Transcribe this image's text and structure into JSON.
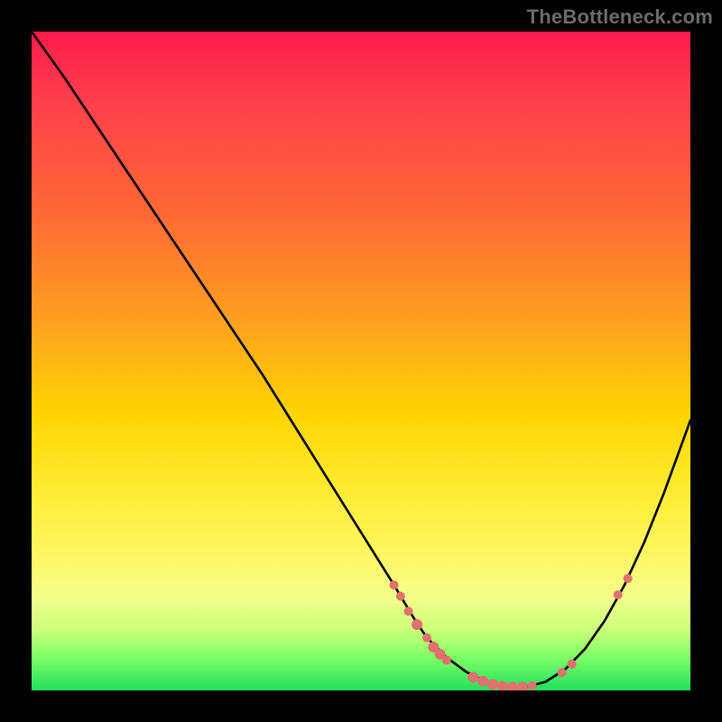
{
  "watermark": "TheBottleneck.com",
  "colors": {
    "background": "#000000",
    "curve": "#000000",
    "marker": "#e36f6f",
    "watermark_text": "#6b6b6b",
    "gradient_top": "#ff1a4d",
    "gradient_bottom": "#1fe05c"
  },
  "chart_data": {
    "type": "line",
    "title": "",
    "xlabel": "",
    "ylabel": "",
    "xlim": [
      0,
      100
    ],
    "ylim": [
      0,
      100
    ],
    "grid": false,
    "curve": {
      "name": "bottleneck-curve",
      "x": [
        0,
        5,
        10,
        15,
        20,
        25,
        30,
        35,
        40,
        45,
        50,
        55,
        58,
        60,
        63,
        66,
        69,
        72,
        75,
        78,
        81,
        84,
        87,
        90,
        93,
        96,
        100
      ],
      "y": [
        100,
        93,
        85.5,
        78,
        70.5,
        63,
        55.5,
        48,
        40,
        32,
        24,
        16,
        11,
        8,
        5,
        2.8,
        1.3,
        0.5,
        0.5,
        1.3,
        3.2,
        6.3,
        10.6,
        16,
        22.5,
        30,
        41
      ]
    },
    "markers": [
      {
        "x": 55,
        "y": 16,
        "r": 5
      },
      {
        "x": 56,
        "y": 14.3,
        "r": 5
      },
      {
        "x": 57.2,
        "y": 12,
        "r": 5
      },
      {
        "x": 58.5,
        "y": 10,
        "r": 6
      },
      {
        "x": 60,
        "y": 8,
        "r": 5
      },
      {
        "x": 61,
        "y": 6.6,
        "r": 6
      },
      {
        "x": 62,
        "y": 5.5,
        "r": 6
      },
      {
        "x": 63,
        "y": 4.6,
        "r": 5
      },
      {
        "x": 67,
        "y": 2.0,
        "r": 6
      },
      {
        "x": 68.5,
        "y": 1.4,
        "r": 6
      },
      {
        "x": 70,
        "y": 0.9,
        "r": 6
      },
      {
        "x": 71.5,
        "y": 0.6,
        "r": 6
      },
      {
        "x": 73,
        "y": 0.5,
        "r": 6
      },
      {
        "x": 74.5,
        "y": 0.5,
        "r": 6
      },
      {
        "x": 76,
        "y": 0.7,
        "r": 5
      },
      {
        "x": 80.5,
        "y": 2.7,
        "r": 5
      },
      {
        "x": 82,
        "y": 4.0,
        "r": 5
      },
      {
        "x": 89,
        "y": 14.5,
        "r": 5
      },
      {
        "x": 90.5,
        "y": 17,
        "r": 5
      }
    ]
  }
}
